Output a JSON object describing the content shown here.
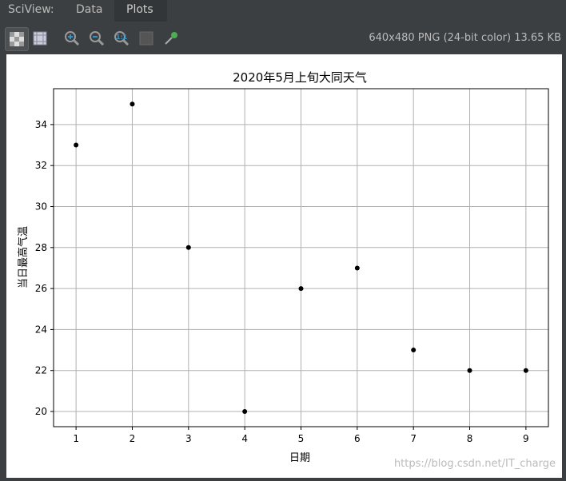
{
  "tabs": {
    "prefix": "SciView:",
    "data": "Data",
    "plots": "Plots"
  },
  "toolbar": {
    "info": "640x480 PNG (24-bit color) 13.65 KB"
  },
  "watermark": "https://blog.csdn.net/IT_charge",
  "chart_data": {
    "type": "scatter",
    "title": "2020年5月上旬大同天气",
    "xlabel": "日期",
    "ylabel": "当日最高气温",
    "x": [
      1,
      2,
      3,
      4,
      5,
      6,
      7,
      8,
      9
    ],
    "y": [
      33,
      35,
      28,
      20,
      26,
      27,
      23,
      22,
      22
    ],
    "xlim": [
      0.6,
      9.4
    ],
    "ylim": [
      19.26,
      35.75
    ],
    "xticks": [
      1,
      2,
      3,
      4,
      5,
      6,
      7,
      8,
      9
    ],
    "yticks": [
      20,
      22,
      24,
      26,
      28,
      30,
      32,
      34
    ],
    "grid": true,
    "marker_color": "#000000"
  }
}
